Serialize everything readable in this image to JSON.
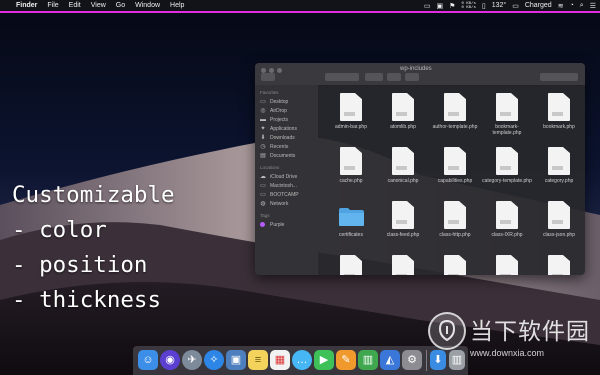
{
  "menu_bar": {
    "app_name": "Finder",
    "items": [
      "File",
      "Edit",
      "View",
      "Go",
      "Window",
      "Help"
    ],
    "status": {
      "net_up": "0 KB/s",
      "net_down": "0 KB/s",
      "temperature": "132°",
      "battery": "Charged"
    },
    "underline_color": "#e02be0"
  },
  "finder": {
    "title": "wp-includes",
    "sidebar": {
      "favorites_header": "Favorites",
      "favorites": [
        {
          "label": "Desktop",
          "icon": "desktop-icon"
        },
        {
          "label": "AirDrop",
          "icon": "airdrop-icon"
        },
        {
          "label": "Projects",
          "icon": "folder-icon"
        },
        {
          "label": "Applications",
          "icon": "applications-icon"
        },
        {
          "label": "Downloads",
          "icon": "downloads-icon"
        },
        {
          "label": "Recents",
          "icon": "recents-icon"
        },
        {
          "label": "Documents",
          "icon": "documents-icon"
        }
      ],
      "locations_header": "Locations",
      "locations": [
        {
          "label": "iCloud Drive",
          "icon": "cloud-icon"
        },
        {
          "label": "Macintosh...",
          "icon": "disk-icon"
        },
        {
          "label": "BOOTCAMP",
          "icon": "disk-icon"
        },
        {
          "label": "Network",
          "icon": "network-icon"
        }
      ],
      "tags_header": "Tags",
      "tags": [
        {
          "label": "Purple",
          "color": "#b45cff"
        }
      ]
    },
    "files": [
      "admin-bar.php",
      "atomlib.php",
      "author-template.php",
      "bookmark-template.php",
      "bookmark.php",
      "cache.php",
      "canonical.php",
      "capabilities.php",
      "category-template.php",
      "category.php",
      "certificates",
      "class-feed.php",
      "class-http.php",
      "class-IXR.php",
      "class-json.php",
      "",
      "",
      "",
      "",
      ""
    ]
  },
  "caption": {
    "line1": "Customizable",
    "line2": "- color",
    "line3": "- position",
    "line4": "- thickness"
  },
  "dock": {
    "apps": [
      {
        "name": "finder-icon",
        "color": "#3d8ee8"
      },
      {
        "name": "siri-icon",
        "color": "#5a3fd1"
      },
      {
        "name": "launchpad-icon",
        "color": "#7d8a9a"
      },
      {
        "name": "safari-icon",
        "color": "#2d86e6"
      },
      {
        "name": "preview-icon",
        "color": "#4d7fbf"
      },
      {
        "name": "notes-icon",
        "color": "#f3d35c"
      },
      {
        "name": "calendar-icon",
        "color": "#f2f2f2"
      },
      {
        "name": "messages-icon",
        "color": "#46b6f5"
      },
      {
        "name": "facetime-icon",
        "color": "#3ec158"
      },
      {
        "name": "pages-icon",
        "color": "#f09a2e"
      },
      {
        "name": "numbers-icon",
        "color": "#3fa74e"
      },
      {
        "name": "keynote-icon",
        "color": "#3b77d8"
      },
      {
        "name": "system-preferences-icon",
        "color": "#8c8c92"
      },
      {
        "name": "downloads-stack-icon",
        "color": "#3a8be2"
      },
      {
        "name": "trash-icon",
        "color": "#9aa0a6"
      }
    ]
  },
  "watermark": {
    "chinese": "当下软件园",
    "url": "www.downxia.com"
  }
}
